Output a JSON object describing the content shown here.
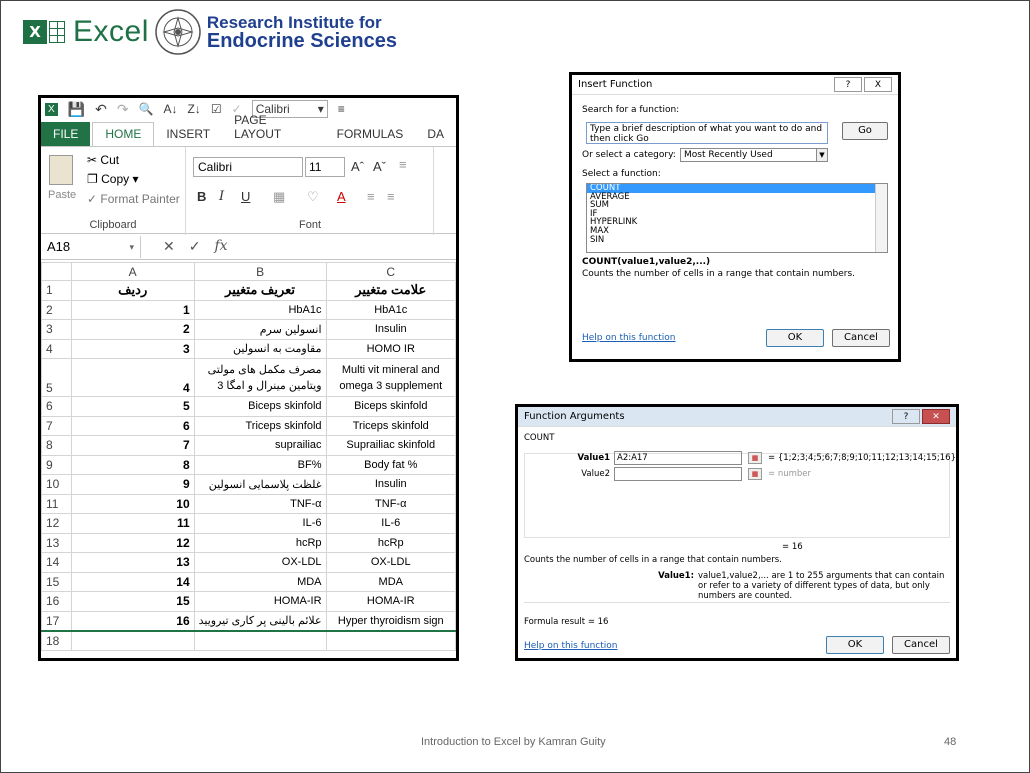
{
  "header": {
    "excel_word": "Excel",
    "institute_line1": "Research Institute for",
    "institute_line2": "Endocrine Sciences"
  },
  "excel": {
    "qat_font": "Calibri",
    "tabs": [
      "FILE",
      "HOME",
      "INSERT",
      "PAGE LAYOUT",
      "FORMULAS",
      "DA"
    ],
    "clipboard": {
      "cut": "Cut",
      "copy": "Copy",
      "paste": "Paste",
      "format_painter": "Format Painter",
      "label": "Clipboard"
    },
    "font_group": {
      "font_name": "Calibri",
      "font_size": "11",
      "label": "Font"
    },
    "name_box": "A18",
    "fx": "fx",
    "columns": [
      "A",
      "B",
      "C"
    ],
    "rows": [
      {
        "n": "1",
        "a": "ردیف",
        "b": "تعریف متغییر",
        "c": "علامت متغییر"
      },
      {
        "n": "2",
        "a": "1",
        "b": "HbA1c",
        "c": "HbA1c"
      },
      {
        "n": "3",
        "a": "2",
        "b": "انسولین سرم",
        "c": "Insulin"
      },
      {
        "n": "4",
        "a": "3",
        "b": "مقاومت به انسولین",
        "c": "HOMO IR"
      },
      {
        "n": "5",
        "a": "4",
        "b": "مصرف مکمل های مولتی ویتامین مینرال و امگا 3",
        "c": "Multi vit mineral and omega 3 supplement"
      },
      {
        "n": "6",
        "a": "5",
        "b": "Biceps skinfold",
        "c": "Biceps skinfold"
      },
      {
        "n": "7",
        "a": "6",
        "b": "Triceps skinfold",
        "c": "Triceps skinfold"
      },
      {
        "n": "8",
        "a": "7",
        "b": "suprailiac",
        "c": "Suprailiac skinfold"
      },
      {
        "n": "9",
        "a": "8",
        "b": "BF%",
        "c": "Body fat %"
      },
      {
        "n": "10",
        "a": "9",
        "b": "غلظت پلاسمایی انسولین",
        "c": "Insulin"
      },
      {
        "n": "11",
        "a": "10",
        "b": "TNF-α",
        "c": "TNF-α"
      },
      {
        "n": "12",
        "a": "11",
        "b": "IL-6",
        "c": "IL-6"
      },
      {
        "n": "13",
        "a": "12",
        "b": "hcRp",
        "c": "hcRp"
      },
      {
        "n": "14",
        "a": "13",
        "b": "OX-LDL",
        "c": "OX-LDL"
      },
      {
        "n": "15",
        "a": "14",
        "b": "MDA",
        "c": "MDA"
      },
      {
        "n": "16",
        "a": "15",
        "b": "HOMA-IR",
        "c": "HOMA-IR"
      },
      {
        "n": "17",
        "a": "16",
        "b": "علائم بالینی پر کاری تیرویید",
        "c": "Hyper thyroidism sign"
      },
      {
        "n": "18",
        "a": "",
        "b": "",
        "c": ""
      }
    ]
  },
  "insert_function": {
    "title": "Insert Function",
    "help_btn": "?",
    "close_btn": "X",
    "search_label": "Search for a function:",
    "search_value": "Type a brief description of what you want to do and then click Go",
    "go": "Go",
    "category_label": "Or select a category:",
    "category_value": "Most Recently Used",
    "select_label": "Select a function:",
    "functions": [
      "COUNT",
      "AVERAGE",
      "SUM",
      "IF",
      "HYPERLINK",
      "MAX",
      "SIN"
    ],
    "signature": "COUNT(value1,value2,...)",
    "description": "Counts the number of cells in a range that contain numbers.",
    "help_link": "Help on this function",
    "ok": "OK",
    "cancel": "Cancel"
  },
  "function_arguments": {
    "title": "Function Arguments",
    "section": "COUNT",
    "value1_label": "Value1",
    "value1": "A2:A17",
    "value1_result": "= {1;2;3;4;5;6;7;8;9;10;11;12;13;14;15;16}",
    "value2_label": "Value2",
    "value2_result": "= number",
    "total": "= 16",
    "description": "Counts the number of cells in a range that contain numbers.",
    "arg_name": "Value1:",
    "arg_help": "value1,value2,... are 1 to 255 arguments that can contain or refer to a variety of different types of data, but only numbers are counted.",
    "formula_result": "Formula result =  16",
    "help_link": "Help on this function",
    "ok": "OK",
    "cancel": "Cancel"
  },
  "footer": {
    "text": "Introduction to Excel by Kamran Guity",
    "page": "48"
  },
  "colors": {
    "excel_green": "#217346",
    "institute_blue": "#1f3f8f",
    "selection_blue": "#3399ff"
  }
}
